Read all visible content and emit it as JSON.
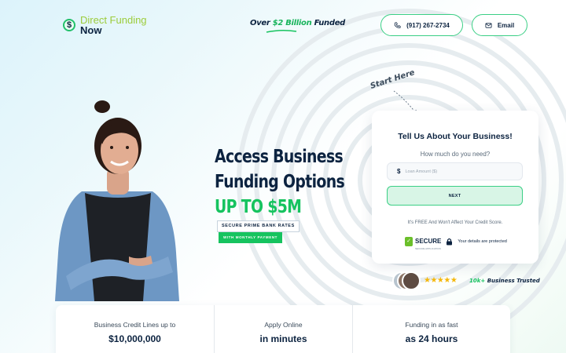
{
  "header": {
    "logo_line1": "Direct Funding",
    "logo_line2": "Now",
    "logo_symbol": "$",
    "funded_pre": "Over ",
    "funded_highlight": "$2 Billion",
    "funded_post": " Funded",
    "phone_label": "(917) 267-2734",
    "email_label": "Email"
  },
  "hero": {
    "line1": "Access Business",
    "line2": "Funding Options",
    "line3": "UP TO $5M",
    "tag_secure": "SECURE PRIME BANK RATES",
    "tag_monthly": "WITH MONTHLY PAYMENT",
    "start_here": "Start Here"
  },
  "form": {
    "title": "Tell Us About Your Business!",
    "subtitle": "How much do you need?",
    "currency_symbol": "$",
    "amount_placeholder": "Loan Amount ($)",
    "next_label": "NEXT",
    "free_note": "It's FREE And Won't Affect Your Credit Score.",
    "secure_word": "SECURE",
    "secure_small": "SECURE APPLICATION",
    "protected_note": "Your details are protected"
  },
  "trust": {
    "stars": "★★★★★",
    "count": "10k+",
    "label": " Business Trusted"
  },
  "stats": [
    {
      "label": "Business Credit Lines up to",
      "value": "$10,000,000"
    },
    {
      "label": "Apply Online",
      "value": "in minutes"
    },
    {
      "label": "Funding in as fast",
      "value": "as 24 hours"
    }
  ],
  "colors": {
    "brand_navy": "#0c2340",
    "brand_green": "#16c35f",
    "star_gold": "#f5b70a"
  },
  "icons": {
    "phone": "phone-icon",
    "email": "envelope-icon",
    "lock": "lock-icon"
  }
}
